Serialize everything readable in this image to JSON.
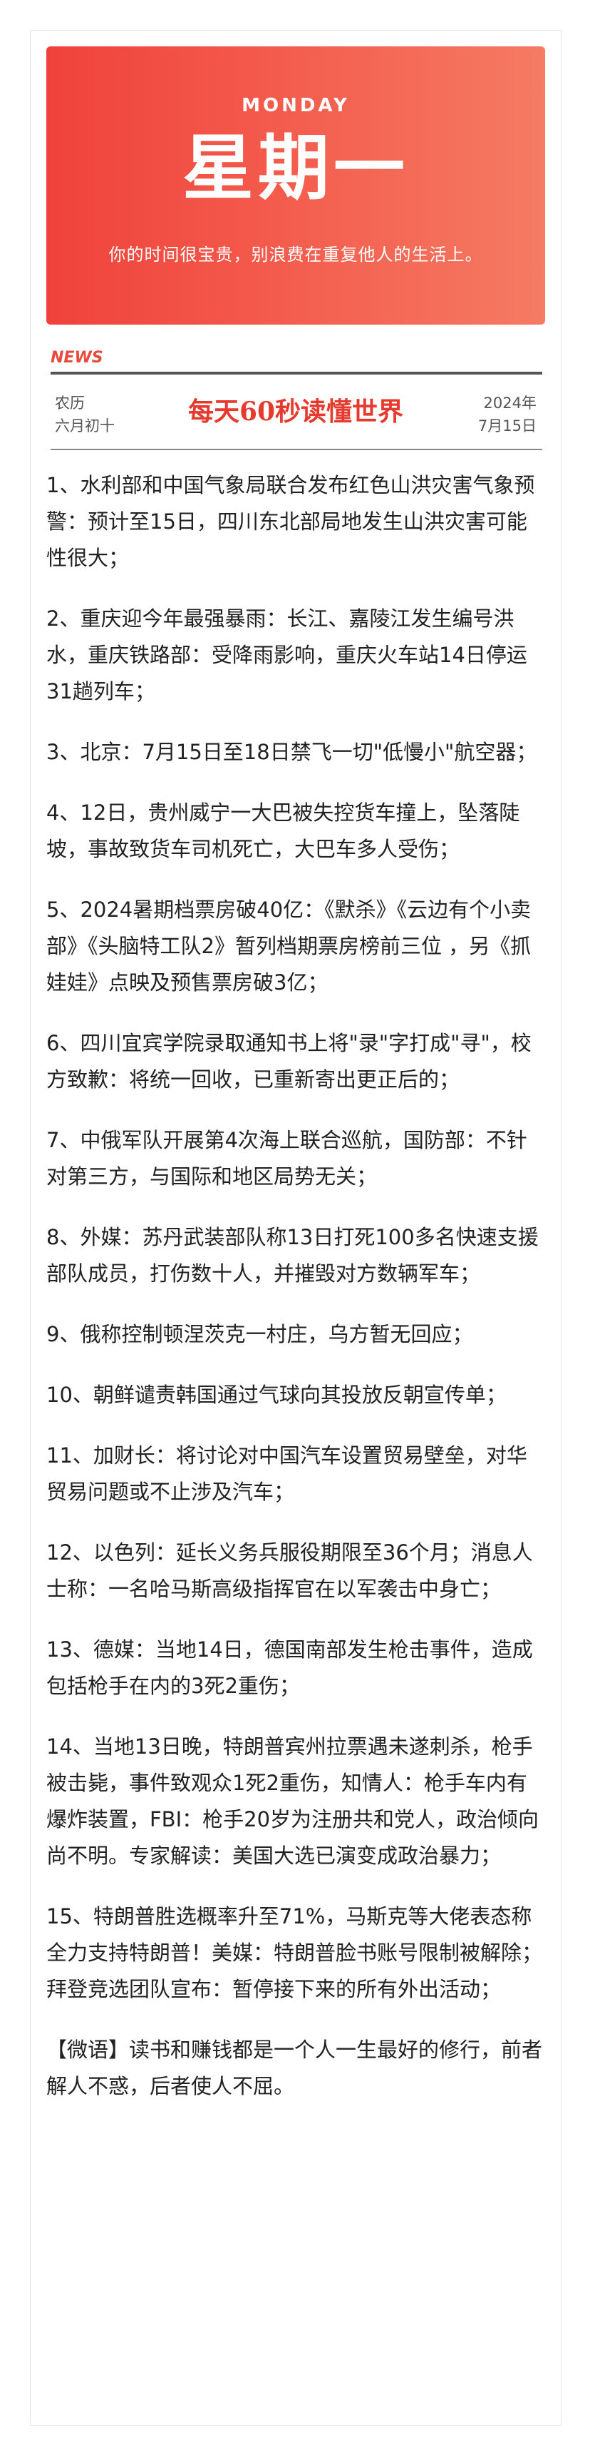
{
  "banner": {
    "day_en": "MONDAY",
    "weekday": "星期一",
    "motto": "你的时间很宝贵，别浪费在重复他人的生活上。"
  },
  "header": {
    "news_label": "NEWS",
    "lunar_label": "农历",
    "lunar_date": "六月初十",
    "title": "每天60秒读懂世界",
    "year": "2024年",
    "date": "7月15日"
  },
  "items": [
    "1、水利部和中国气象局联合发布红色山洪灾害气象预警：预计至15日，四川东北部局地发生山洪灾害可能性很大；",
    "2、重庆迎今年最强暴雨：长江、嘉陵江发生编号洪水，重庆铁路部：受降雨影响，重庆火车站14日停运31趟列车；",
    "3、北京：7月15日至18日禁飞一切\"低慢小\"航空器；",
    "4、12日，贵州威宁一大巴被失控货车撞上，坠落陡坡，事故致货车司机死亡，大巴车多人受伤；",
    "5、2024暑期档票房破40亿：《默杀》《云边有个小卖部》《头脑特工队2》暂列档期票房榜前三位 ，另《抓娃娃》点映及预售票房破3亿；",
    "6、四川宜宾学院录取通知书上将\"录\"字打成\"寻\"，校方致歉：将统一回收，已重新寄出更正后的；",
    "7、中俄军队开展第4次海上联合巡航，国防部：不针对第三方，与国际和地区局势无关；",
    "8、外媒：苏丹武装部队称13日打死100多名快速支援部队成员，打伤数十人，并摧毁对方数辆军车；",
    "9、俄称控制顿涅茨克一村庄，乌方暂无回应；",
    "10、朝鲜谴责韩国通过气球向其投放反朝宣传单；",
    "11、加财长：将讨论对中国汽车设置贸易壁垒，对华贸易问题或不止涉及汽车；",
    "12、以色列：延长义务兵服役期限至36个月；消息人士称：一名哈马斯高级指挥官在以军袭击中身亡；",
    "13、德媒：当地14日，德国南部发生枪击事件，造成包括枪手在内的3死2重伤；",
    "14、当地13日晚，特朗普宾州拉票遇未遂刺杀，枪手被击毙，事件致观众1死2重伤，知情人：枪手车内有爆炸装置，FBI：枪手20岁为注册共和党人，政治倾向尚不明。专家解读：美国大选已演变成政治暴力；",
    "15、特朗普胜选概率升至71%，马斯克等大佬表态称全力支持特朗普！美媒：特朗普脸书账号限制被解除；拜登竞选团队宣布：暂停接下来的所有外出活动；"
  ],
  "quote": "【微语】读书和赚钱都是一个人一生最好的修行，前者解人不惑，后者使人不屈。"
}
